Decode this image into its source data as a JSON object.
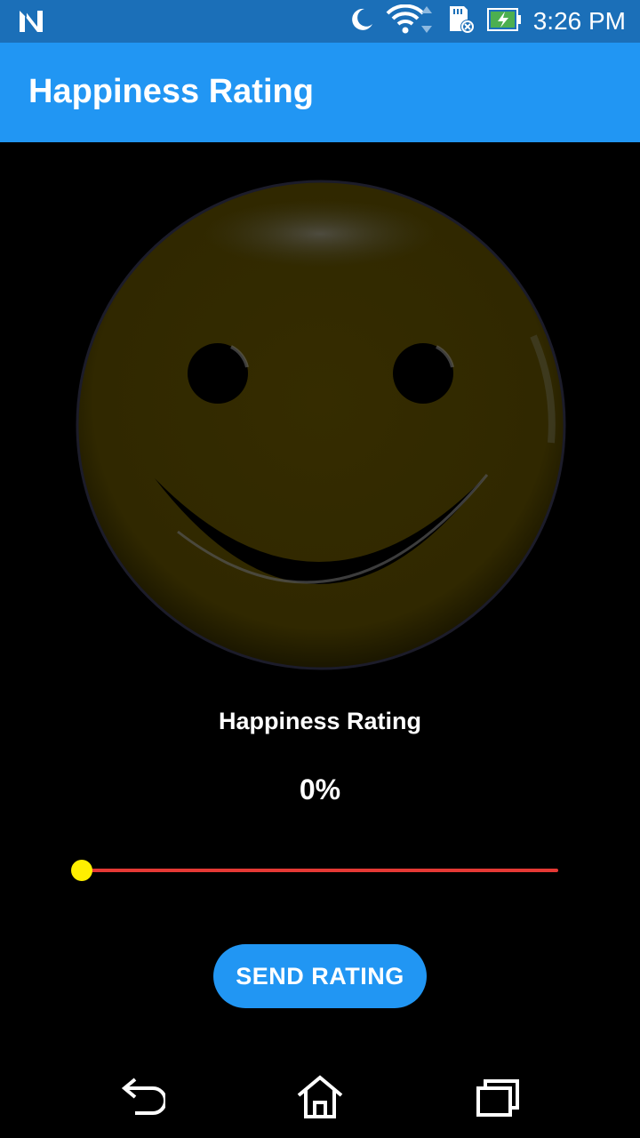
{
  "status_bar": {
    "time": "3:26 PM",
    "icons": [
      "notification-n-icon",
      "do-not-disturb-moon-icon",
      "wifi-icon",
      "sd-card-icon",
      "battery-charging-icon"
    ],
    "background": "#1b6fb8"
  },
  "app_bar": {
    "title": "Happiness Rating",
    "background": "#2196f3"
  },
  "rating": {
    "label": "Happiness Rating",
    "value_text": "0%",
    "value": 0,
    "min": 0,
    "max": 100
  },
  "smiley": {
    "face_color": "#332a00",
    "mood": "smile"
  },
  "slider": {
    "track_color": "#e53935",
    "thumb_color": "#ffef00"
  },
  "send_button": {
    "label": "SEND RATING",
    "background": "#2196f3"
  },
  "nav_bar": {
    "icons": [
      "back-icon",
      "home-icon",
      "recents-icon"
    ]
  }
}
